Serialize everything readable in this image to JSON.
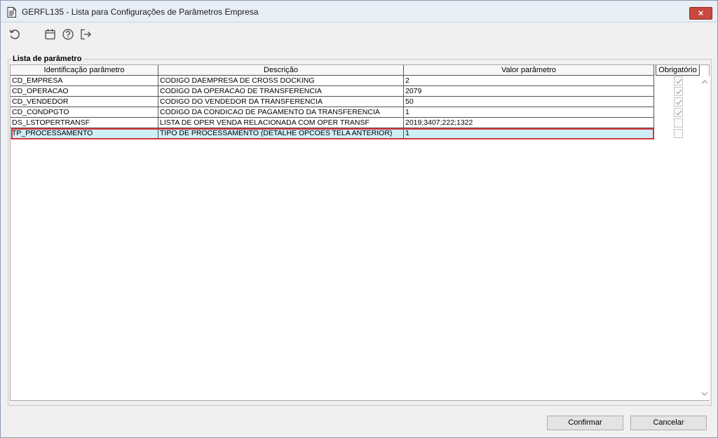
{
  "window": {
    "title": "GERFL135 - Lista para Configurações de Parâmetros Empresa",
    "close_label": "×"
  },
  "toolbar": {
    "buttons": [
      {
        "icon": "refresh-icon"
      },
      {
        "icon": "calendar-icon"
      },
      {
        "icon": "help-icon"
      },
      {
        "icon": "exit-icon"
      }
    ]
  },
  "group": {
    "legend": "Lista de parâmetro"
  },
  "table": {
    "columns": [
      "Identificação parâmetro",
      "Descrição",
      "Valor parâmetro",
      "Obrigatório"
    ],
    "rows": [
      {
        "id": "CD_EMPRESA",
        "desc": "CODIGO DAEMPRESA DE CROSS DOCKING",
        "value": "2",
        "required": true
      },
      {
        "id": "CD_OPERACAO",
        "desc": "CODIGO DA OPERACAO DE TRANSFERENCIA",
        "value": "2079",
        "required": true
      },
      {
        "id": "CD_VENDEDOR",
        "desc": "CODIGO DO VENDEDOR DA TRANSFERENCIA",
        "value": "50",
        "required": true
      },
      {
        "id": "CD_CONDPGTO",
        "desc": "CODIGO DA CONDICAO DE PAGAMENTO DA TRANSFERENCIA",
        "value": "1",
        "required": true
      },
      {
        "id": "DS_LSTOPERTRANSF",
        "desc": "LISTA DE OPER VENDA RELACIONADA COM OPER TRANSF",
        "value": "2019;3407;222;1322",
        "required": false
      },
      {
        "id": "TP_PROCESSAMENTO",
        "desc": "TIPO DE PROCESSAMENTO (DETALHE OPCOES TELA ANTERIOR)",
        "value": "1",
        "required": false
      }
    ],
    "selected_row": 5
  },
  "buttons": {
    "confirm": "Confirmar",
    "cancel": "Cancelar"
  },
  "colors": {
    "selected_row": "#cdf0f7",
    "selection_outline": "#d9363e",
    "close_button": "#c9483f"
  }
}
